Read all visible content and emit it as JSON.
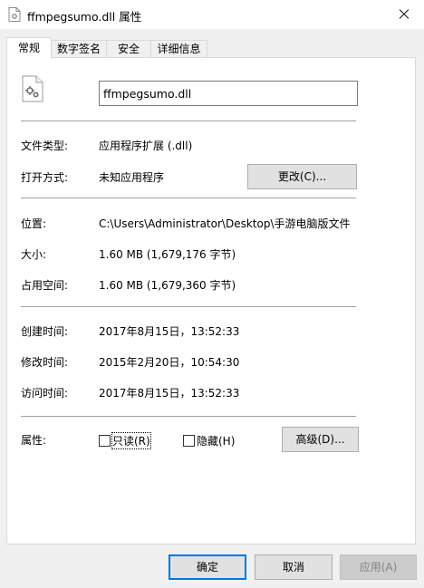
{
  "window": {
    "title": "ffmpegsumo.dll 属性"
  },
  "tabs": [
    {
      "label": "常规"
    },
    {
      "label": "数字签名"
    },
    {
      "label": "安全"
    },
    {
      "label": "详细信息"
    }
  ],
  "general": {
    "file_name": "ffmpegsumo.dll",
    "type_label": "文件类型:",
    "type_value": "应用程序扩展 (.dll)",
    "opens_with_label": "打开方式:",
    "opens_with_value": "未知应用程序",
    "change_button": "更改(C)...",
    "location_label": "位置:",
    "location_value": "C:\\Users\\Administrator\\Desktop\\手游电脑版文件",
    "size_label": "大小:",
    "size_value": "1.60 MB (1,679,176 字节)",
    "size_on_disk_label": "占用空间:",
    "size_on_disk_value": "1.60 MB (1,679,360 字节)",
    "created_label": "创建时间:",
    "created_value": "2017年8月15日，13:52:33",
    "modified_label": "修改时间:",
    "modified_value": "2015年2月20日，10:54:30",
    "accessed_label": "访问时间:",
    "accessed_value": "2017年8月15日，13:52:33",
    "attributes_label": "属性:",
    "readonly_label": "只读(R)",
    "readonly_checked": false,
    "hidden_label": "隐藏(H)",
    "hidden_checked": false,
    "advanced_button": "高级(D)..."
  },
  "footer": {
    "ok": "确定",
    "cancel": "取消",
    "apply": "应用(A)"
  },
  "colors": {
    "accent": "#0078d7"
  }
}
